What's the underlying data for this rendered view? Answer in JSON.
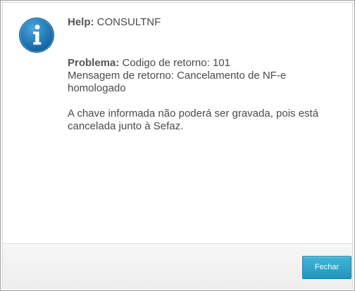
{
  "dialog": {
    "help_label": "Help:",
    "help_value": "CONSULTNF",
    "problem_label": "Problema:",
    "problem_text": "Codigo de retorno: 101",
    "message_line": "Mensagem de retorno: Cancelamento de NF-e homologado",
    "solution_text": "A chave informada não poderá ser gravada, pois está cancelada junto à Sefaz."
  },
  "footer": {
    "close_label": "Fechar"
  },
  "icon": "info-icon",
  "colors": {
    "accent": "#2a9dc4",
    "icon_blue": "#1e78b4"
  }
}
